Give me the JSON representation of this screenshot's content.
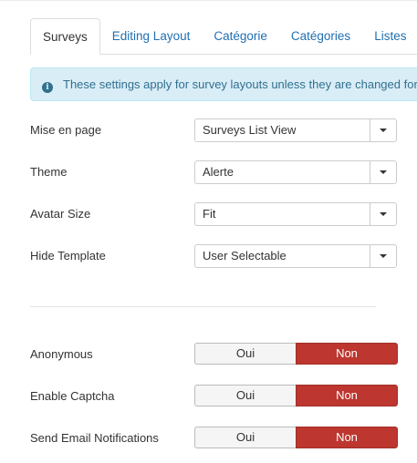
{
  "tabs": [
    {
      "label": "Surveys",
      "active": true
    },
    {
      "label": "Editing Layout",
      "active": false
    },
    {
      "label": "Catégorie",
      "active": false
    },
    {
      "label": "Catégories",
      "active": false
    },
    {
      "label": "Listes",
      "active": false
    }
  ],
  "alert": {
    "icon": "info-icon",
    "text": "These settings apply for survey layouts unless they are changed for"
  },
  "select_fields": [
    {
      "label": "Mise en page",
      "value": "Surveys List View"
    },
    {
      "label": "Theme",
      "value": "Alerte"
    },
    {
      "label": "Avatar Size",
      "value": "Fit"
    },
    {
      "label": "Hide Template",
      "value": "User Selectable"
    }
  ],
  "toggle_fields": [
    {
      "label": "Anonymous",
      "yes": "Oui",
      "no": "Non",
      "selected": "Non"
    },
    {
      "label": "Enable Captcha",
      "yes": "Oui",
      "no": "Non",
      "selected": "Non"
    },
    {
      "label": "Send Email Notifications",
      "yes": "Oui",
      "no": "Non",
      "selected": "Non"
    }
  ],
  "colors": {
    "link": "#1f6fb2",
    "alert_bg": "#d9edf7",
    "alert_text": "#31708f",
    "selected_no": "#bd362f"
  }
}
